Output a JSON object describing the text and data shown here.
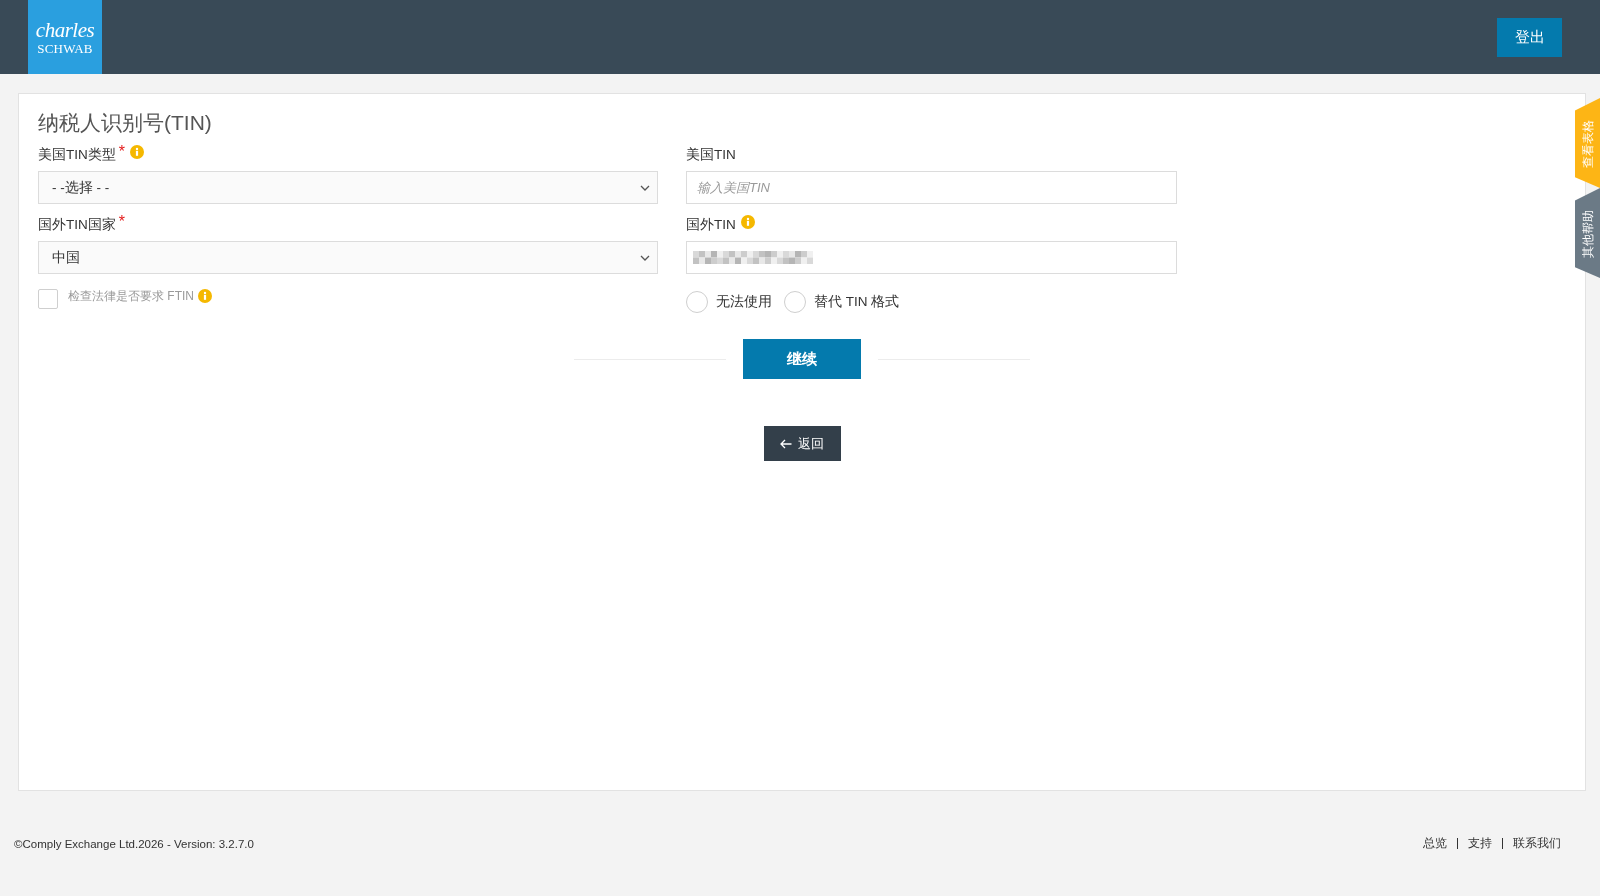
{
  "header": {
    "logo": {
      "script": "charles",
      "caps": "SCHWAB"
    },
    "logout_button": "登出"
  },
  "side_tabs": [
    {
      "label": "查看表格",
      "color": "#fdb515"
    },
    {
      "label": "其他帮助",
      "color": "#6b7a86"
    }
  ],
  "form": {
    "title": "纳税人识别号(TIN)",
    "columns": [
      {
        "fields": [
          {
            "kind": "select",
            "label": "美国TIN类型",
            "required_mark": "*",
            "info_icon": true,
            "value": "- -选择 - -"
          },
          {
            "kind": "select",
            "label": "国外TIN国家",
            "required_mark": "*",
            "value": "中国"
          },
          {
            "kind": "checkbox",
            "label": "检查法律是否要求 FTIN",
            "info_icon": true,
            "checked": false
          }
        ]
      },
      {
        "fields": [
          {
            "kind": "text_input",
            "label": "美国TIN",
            "placeholder": "输入美国TIN"
          },
          {
            "kind": "text_input",
            "label": "国外TIN",
            "info_icon": true,
            "value_redacted": true
          },
          {
            "kind": "radio_group",
            "options": [
              {
                "label": "无法使用",
                "selected": false
              },
              {
                "label": "替代 TIN 格式",
                "selected": false
              }
            ]
          }
        ]
      }
    ],
    "continue_button": "继续",
    "back_button": "返回"
  },
  "footer": {
    "copyright": "©Comply Exchange Ltd.2026 - Version: 3.2.7.0",
    "links": [
      "总览",
      "支持",
      "联系我们"
    ]
  }
}
